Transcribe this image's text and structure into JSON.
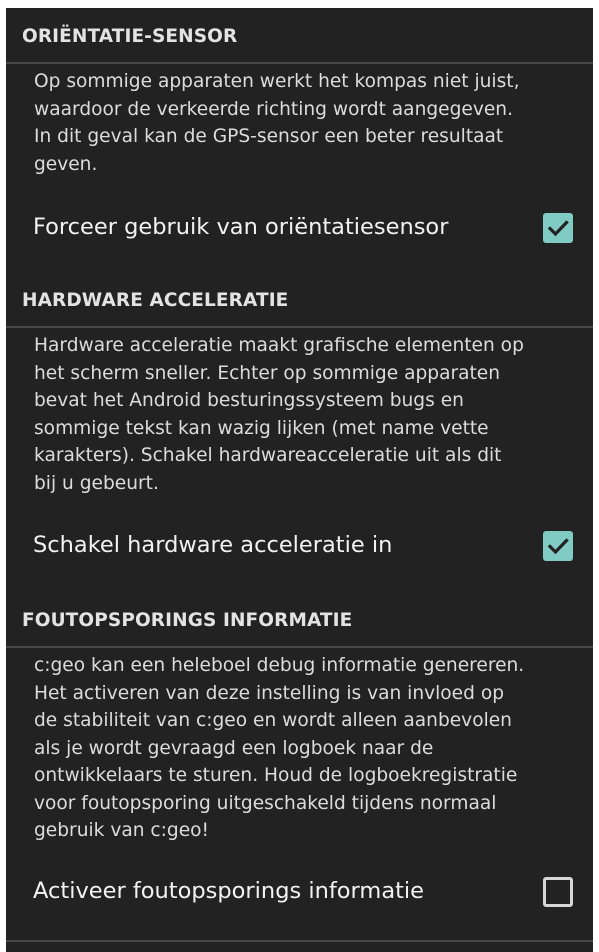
{
  "sections": [
    {
      "title": "ORIËNTATIE-SENSOR",
      "summary": [
        "Op sommige apparaten werkt het kompas niet juist,",
        "waardoor de verkeerde richting wordt aangegeven.",
        "In dit geval kan de GPS-sensor een beter resultaat",
        "geven."
      ],
      "preference": {
        "label": "Forceer gebruik van oriëntatiesensor",
        "checked": true
      }
    },
    {
      "title": "HARDWARE ACCELERATIE",
      "summary": [
        "Hardware acceleratie maakt grafische elementen op",
        "het scherm sneller. Echter op sommige apparaten",
        "bevat het Android besturingssysteem bugs en",
        "sommige tekst kan wazig lijken (met name vette",
        "karakters). Schakel hardwareacceleratie uit als dit",
        "bij u gebeurt."
      ],
      "preference": {
        "label": "Schakel hardware acceleratie in",
        "checked": true
      }
    },
    {
      "title": "FOUTOPSPORINGS INFORMATIE",
      "summary": [
        "c:geo kan een heleboel debug informatie genereren.",
        "Het activeren van deze instelling is van invloed op",
        "de stabiliteit van c:geo en wordt alleen aanbevolen",
        "als je wordt gevraagd een logboek naar de",
        "ontwikkelaars te sturen. Houd de logboekregistratie",
        "voor foutopsporing uitgeschakeld tijdens normaal",
        "gebruik van c:geo!"
      ],
      "preference": {
        "label": "Activeer foutopsporings informatie",
        "checked": false
      }
    }
  ],
  "colors": {
    "background": "#222222",
    "divider": "#474747",
    "checkbox_accent": "#80cbc4",
    "check_mark": "#222222"
  },
  "icons": {
    "checked": "checkbox-checked-icon",
    "unchecked": "checkbox-unchecked-icon"
  }
}
